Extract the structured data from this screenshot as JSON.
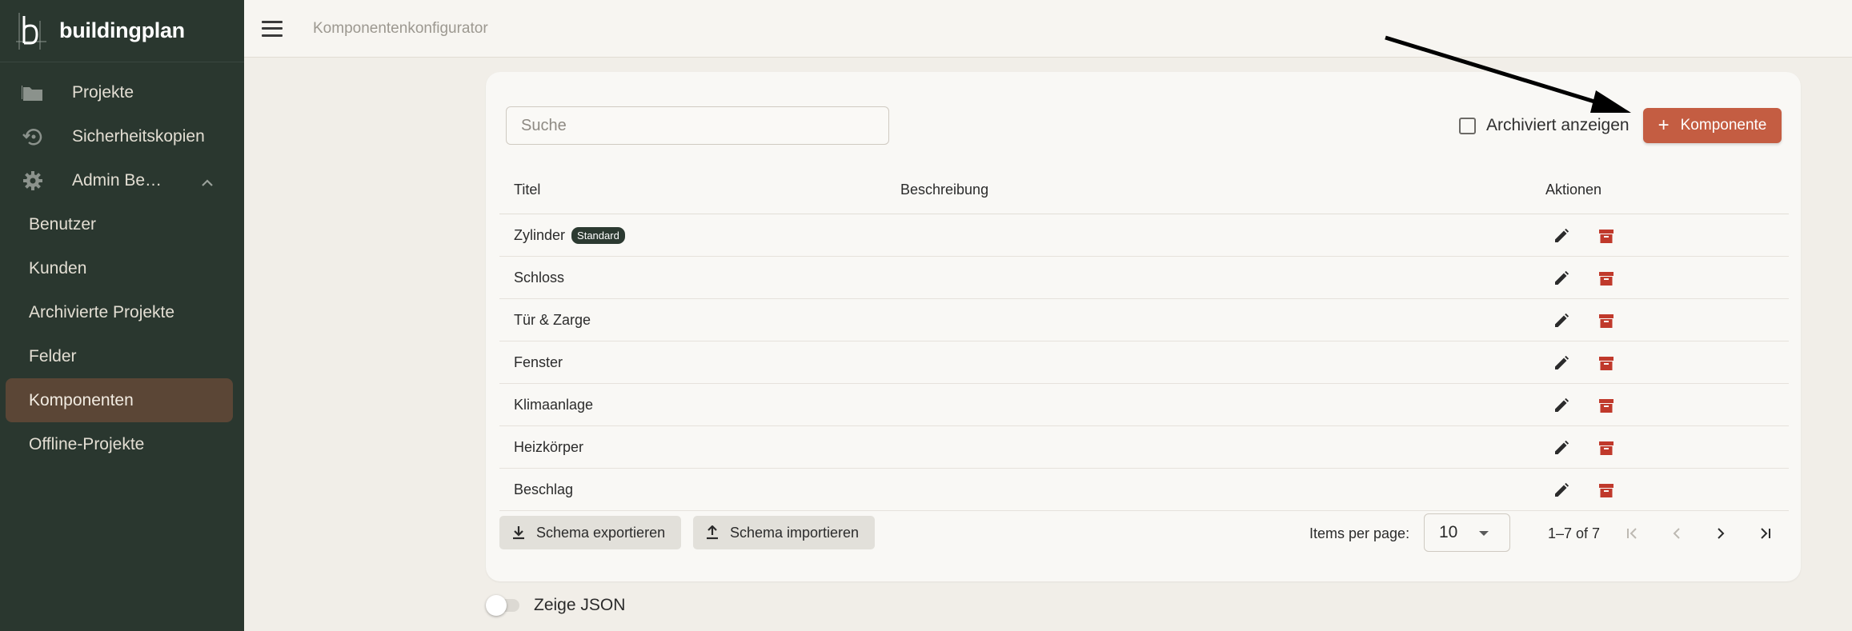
{
  "brand": {
    "name": "buildingplan"
  },
  "sidebar": {
    "items": [
      {
        "label": "Projekte",
        "icon": "folder-icon"
      },
      {
        "label": "Sicherheitskopien",
        "icon": "backup-restore-icon"
      },
      {
        "label": "Admin Be…",
        "icon": "gear-icon",
        "expanded": true
      }
    ],
    "sub_items": [
      {
        "label": "Benutzer"
      },
      {
        "label": "Kunden"
      },
      {
        "label": "Archivierte Projekte"
      },
      {
        "label": "Felder"
      },
      {
        "label": "Komponenten",
        "active": true
      },
      {
        "label": "Offline-Projekte"
      }
    ]
  },
  "topbar": {
    "breadcrumb": "Komponentenkonfigurator"
  },
  "toolbar": {
    "search_placeholder": "Suche",
    "archived_label": "Archiviert anzeigen",
    "add_label": "Komponente"
  },
  "table": {
    "headers": {
      "title": "Titel",
      "description": "Beschreibung",
      "actions": "Aktionen"
    },
    "rows": [
      {
        "title": "Zylinder",
        "badge": "Standard",
        "description": ""
      },
      {
        "title": "Schloss",
        "description": ""
      },
      {
        "title": "Tür & Zarge",
        "description": ""
      },
      {
        "title": "Fenster",
        "description": ""
      },
      {
        "title": "Klimaanlage",
        "description": ""
      },
      {
        "title": "Heizkörper",
        "description": ""
      },
      {
        "title": "Beschlag",
        "description": ""
      }
    ]
  },
  "footer": {
    "export_label": "Schema exportieren",
    "import_label": "Schema importieren",
    "items_per_page_label": "Items per page:",
    "items_per_page_value": "10",
    "range_label": "1–7 of 7"
  },
  "json_toggle": {
    "label": "Zeige JSON",
    "checked": false
  },
  "colors": {
    "sidebar_bg": "#2a372f",
    "active_item_bg": "#5b4636",
    "accent": "#c45d42",
    "archive_icon": "#c0392b",
    "badge_bg": "#2c3a31"
  }
}
